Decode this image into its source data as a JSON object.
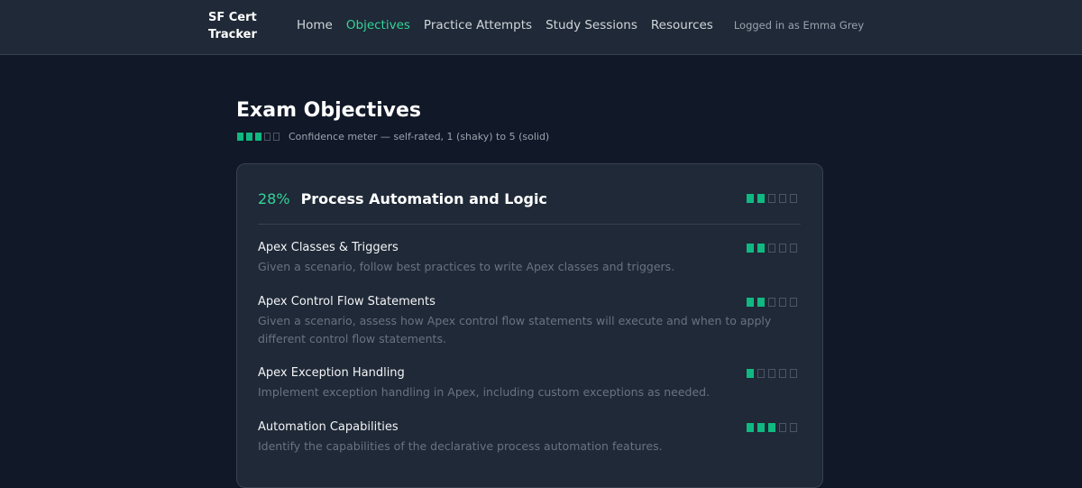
{
  "nav": {
    "brand": "SF Cert Tracker",
    "links": [
      {
        "label": "Home",
        "active": false
      },
      {
        "label": "Objectives",
        "active": true
      },
      {
        "label": "Practice Attempts",
        "active": false
      },
      {
        "label": "Study Sessions",
        "active": false
      },
      {
        "label": "Resources",
        "active": false
      }
    ],
    "user_text": "Logged in as Emma Grey"
  },
  "page": {
    "title": "Exam Objectives",
    "legend_text": "Confidence meter — self-rated, 1 (shaky) to 5 (solid)",
    "legend_level": 3,
    "meter_max": 5
  },
  "section": {
    "percent": "28%",
    "title": "Process Automation and Logic",
    "confidence": 2,
    "objectives": [
      {
        "title": "Apex Classes & Triggers",
        "description": "Given a scenario, follow best practices to write Apex classes and triggers.",
        "confidence": 2
      },
      {
        "title": "Apex Control Flow Statements",
        "description": "Given a scenario, assess how Apex control flow statements will execute and when to apply different control flow statements.",
        "confidence": 2
      },
      {
        "title": "Apex Exception Handling",
        "description": "Implement exception handling in Apex, including custom exceptions as needed.",
        "confidence": 1
      },
      {
        "title": "Automation Capabilities",
        "description": "Identify the capabilities of the declarative process automation features.",
        "confidence": 3
      }
    ]
  },
  "colors": {
    "accent": "#34d399",
    "meter_on": "#10b981",
    "background": "#111827",
    "card": "#1f2937"
  }
}
